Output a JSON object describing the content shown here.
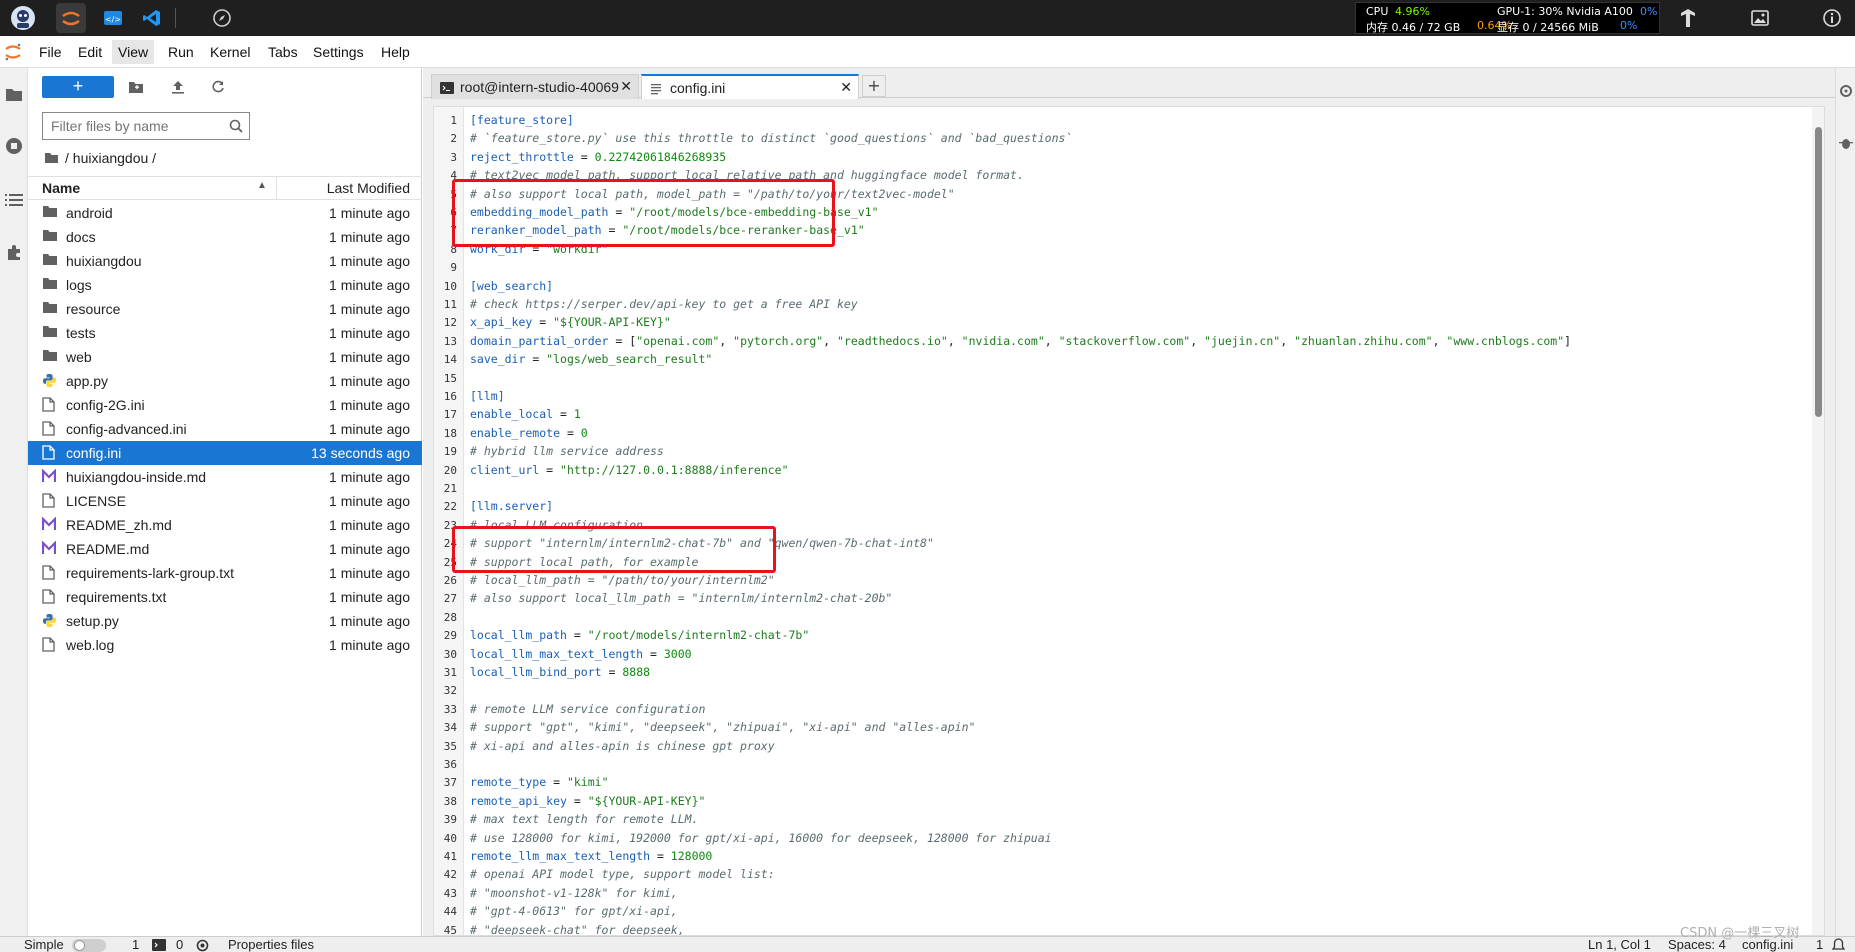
{
  "resource_monitor": {
    "cpu_label": "CPU",
    "cpu_value": "4.96%",
    "mem_label": "内存 0.46 / 72 GB",
    "mem_value": "0.64%",
    "gpu_label": "GPU-1: 30% Nvidia A100",
    "gpu_value": "0%",
    "vram_label": "显存 0 / 24566 MiB",
    "vram_value": "0%"
  },
  "menu": [
    "File",
    "Edit",
    "View",
    "Run",
    "Kernel",
    "Tabs",
    "Settings",
    "Help"
  ],
  "filebrowser": {
    "new_label": "+",
    "filter_placeholder": "Filter files by name",
    "breadcrumb": "/ huixiangdou /",
    "col_name": "Name",
    "col_modified": "Last Modified",
    "files": [
      {
        "name": "android",
        "type": "folder",
        "modified": "1 minute ago"
      },
      {
        "name": "docs",
        "type": "folder",
        "modified": "1 minute ago"
      },
      {
        "name": "huixiangdou",
        "type": "folder",
        "modified": "1 minute ago"
      },
      {
        "name": "logs",
        "type": "folder",
        "modified": "1 minute ago"
      },
      {
        "name": "resource",
        "type": "folder",
        "modified": "1 minute ago"
      },
      {
        "name": "tests",
        "type": "folder",
        "modified": "1 minute ago"
      },
      {
        "name": "web",
        "type": "folder",
        "modified": "1 minute ago"
      },
      {
        "name": "app.py",
        "type": "python",
        "modified": "1 minute ago"
      },
      {
        "name": "config-2G.ini",
        "type": "file",
        "modified": "1 minute ago"
      },
      {
        "name": "config-advanced.ini",
        "type": "file",
        "modified": "1 minute ago"
      },
      {
        "name": "config.ini",
        "type": "file",
        "modified": "13 seconds ago",
        "selected": true
      },
      {
        "name": "huixiangdou-inside.md",
        "type": "markdown",
        "modified": "1 minute ago"
      },
      {
        "name": "LICENSE",
        "type": "file",
        "modified": "1 minute ago"
      },
      {
        "name": "README_zh.md",
        "type": "markdown",
        "modified": "1 minute ago"
      },
      {
        "name": "README.md",
        "type": "markdown",
        "modified": "1 minute ago"
      },
      {
        "name": "requirements-lark-group.txt",
        "type": "file",
        "modified": "1 minute ago"
      },
      {
        "name": "requirements.txt",
        "type": "file",
        "modified": "1 minute ago"
      },
      {
        "name": "setup.py",
        "type": "python",
        "modified": "1 minute ago"
      },
      {
        "name": "web.log",
        "type": "file",
        "modified": "1 minute ago"
      }
    ]
  },
  "tabs": [
    {
      "label": "root@intern-studio-40069",
      "type": "terminal",
      "active": false
    },
    {
      "label": "config.ini",
      "type": "file",
      "active": true
    }
  ],
  "code_lines": [
    [
      [
        "p",
        "[feature_store]"
      ]
    ],
    [
      [
        "c",
        "# `feature_store.py` use this throttle to distinct `good_questions` and `bad_questions`"
      ]
    ],
    [
      [
        "k",
        "reject_throttle"
      ],
      [
        "o",
        " = "
      ],
      [
        "n",
        "0.22742061846268935"
      ]
    ],
    [
      [
        "c",
        "# text2vec model path, support local relative path and huggingface model format."
      ]
    ],
    [
      [
        "c",
        "# also support local path, model_path = \"/path/to/your/text2vec-model\""
      ]
    ],
    [
      [
        "k",
        "embedding_model_path"
      ],
      [
        "o",
        " = "
      ],
      [
        "s",
        "\"/root/models/bce-embedding-base_v1\""
      ]
    ],
    [
      [
        "k",
        "reranker_model_path"
      ],
      [
        "o",
        " = "
      ],
      [
        "s",
        "\"/root/models/bce-reranker-base_v1\""
      ]
    ],
    [
      [
        "k",
        "work_dir"
      ],
      [
        "o",
        " = "
      ],
      [
        "s",
        "\"workdir\""
      ]
    ],
    [],
    [
      [
        "p",
        "[web_search]"
      ]
    ],
    [
      [
        "c",
        "# check https://serper.dev/api-key to get a free API key"
      ]
    ],
    [
      [
        "k",
        "x_api_key"
      ],
      [
        "o",
        " = "
      ],
      [
        "s",
        "\"${YOUR-API-KEY}\""
      ]
    ],
    [
      [
        "k",
        "domain_partial_order"
      ],
      [
        "o",
        " = "
      ],
      [
        "o",
        "["
      ],
      [
        "s",
        "\"openai.com\""
      ],
      [
        "o",
        ", "
      ],
      [
        "s",
        "\"pytorch.org\""
      ],
      [
        "o",
        ", "
      ],
      [
        "s",
        "\"readthedocs.io\""
      ],
      [
        "o",
        ", "
      ],
      [
        "s",
        "\"nvidia.com\""
      ],
      [
        "o",
        ", "
      ],
      [
        "s",
        "\"stackoverflow.com\""
      ],
      [
        "o",
        ", "
      ],
      [
        "s",
        "\"juejin.cn\""
      ],
      [
        "o",
        ", "
      ],
      [
        "s",
        "\"zhuanlan.zhihu.com\""
      ],
      [
        "o",
        ", "
      ],
      [
        "s",
        "\"www.cnblogs.com\""
      ],
      [
        "o",
        "]"
      ]
    ],
    [
      [
        "k",
        "save_dir"
      ],
      [
        "o",
        " = "
      ],
      [
        "s",
        "\"logs/web_search_result\""
      ]
    ],
    [],
    [
      [
        "p",
        "[llm]"
      ]
    ],
    [
      [
        "k",
        "enable_local"
      ],
      [
        "o",
        " = "
      ],
      [
        "n",
        "1"
      ]
    ],
    [
      [
        "k",
        "enable_remote"
      ],
      [
        "o",
        " = "
      ],
      [
        "n",
        "0"
      ]
    ],
    [
      [
        "c",
        "# hybrid llm service address"
      ]
    ],
    [
      [
        "k",
        "client_url"
      ],
      [
        "o",
        " = "
      ],
      [
        "s",
        "\"http://127.0.0.1:8888/inference\""
      ]
    ],
    [],
    [
      [
        "p",
        "[llm.server]"
      ]
    ],
    [
      [
        "c",
        "# local LLM configuration"
      ]
    ],
    [
      [
        "c",
        "# support \"internlm/internlm2-chat-7b\" and \"qwen/qwen-7b-chat-int8\""
      ]
    ],
    [
      [
        "c",
        "# support local path, for example"
      ]
    ],
    [
      [
        "c",
        "# local_llm_path = \"/path/to/your/internlm2\""
      ]
    ],
    [
      [
        "c",
        "# also support local_llm_path = \"internlm/internlm2-chat-20b\""
      ]
    ],
    [],
    [
      [
        "k",
        "local_llm_path"
      ],
      [
        "o",
        " = "
      ],
      [
        "s",
        "\"/root/models/internlm2-chat-7b\""
      ]
    ],
    [
      [
        "k",
        "local_llm_max_text_length"
      ],
      [
        "o",
        " = "
      ],
      [
        "n",
        "3000"
      ]
    ],
    [
      [
        "k",
        "local_llm_bind_port"
      ],
      [
        "o",
        " = "
      ],
      [
        "n",
        "8888"
      ]
    ],
    [],
    [
      [
        "c",
        "# remote LLM service configuration"
      ]
    ],
    [
      [
        "c",
        "# support \"gpt\", \"kimi\", \"deepseek\", \"zhipuai\", \"xi-api\" and \"alles-apin\""
      ]
    ],
    [
      [
        "c",
        "# xi-api and alles-apin is chinese gpt proxy"
      ]
    ],
    [],
    [
      [
        "k",
        "remote_type"
      ],
      [
        "o",
        " = "
      ],
      [
        "s",
        "\"kimi\""
      ]
    ],
    [
      [
        "k",
        "remote_api_key"
      ],
      [
        "o",
        " = "
      ],
      [
        "s",
        "\"${YOUR-API-KEY}\""
      ]
    ],
    [
      [
        "c",
        "# max text length for remote LLM."
      ]
    ],
    [
      [
        "c",
        "# use 128000 for kimi, 192000 for gpt/xi-api, 16000 for deepseek, 128000 for zhipuai"
      ]
    ],
    [
      [
        "k",
        "remote_llm_max_text_length"
      ],
      [
        "o",
        " = "
      ],
      [
        "n",
        "128000"
      ]
    ],
    [
      [
        "c",
        "# openai API model type, support model list:"
      ]
    ],
    [
      [
        "c",
        "# \"moonshot-v1-128k\" for kimi,"
      ]
    ],
    [
      [
        "c",
        "# \"gpt-4-0613\" for gpt/xi-api,"
      ]
    ],
    [
      [
        "c",
        "# \"deepseek-chat\" for deepseek,"
      ]
    ]
  ],
  "statusbar": {
    "mode": "Simple",
    "terminals": "1",
    "kernels": "0",
    "properties": "Properties files",
    "cursor": "Ln 1, Col 1",
    "spaces": "Spaces: 4",
    "filename": "config.ini",
    "extra": "1"
  },
  "watermark": "CSDN @一棵三叉树",
  "colors": {
    "accent": "#1976d2",
    "highlight_box": "#e8121b"
  }
}
